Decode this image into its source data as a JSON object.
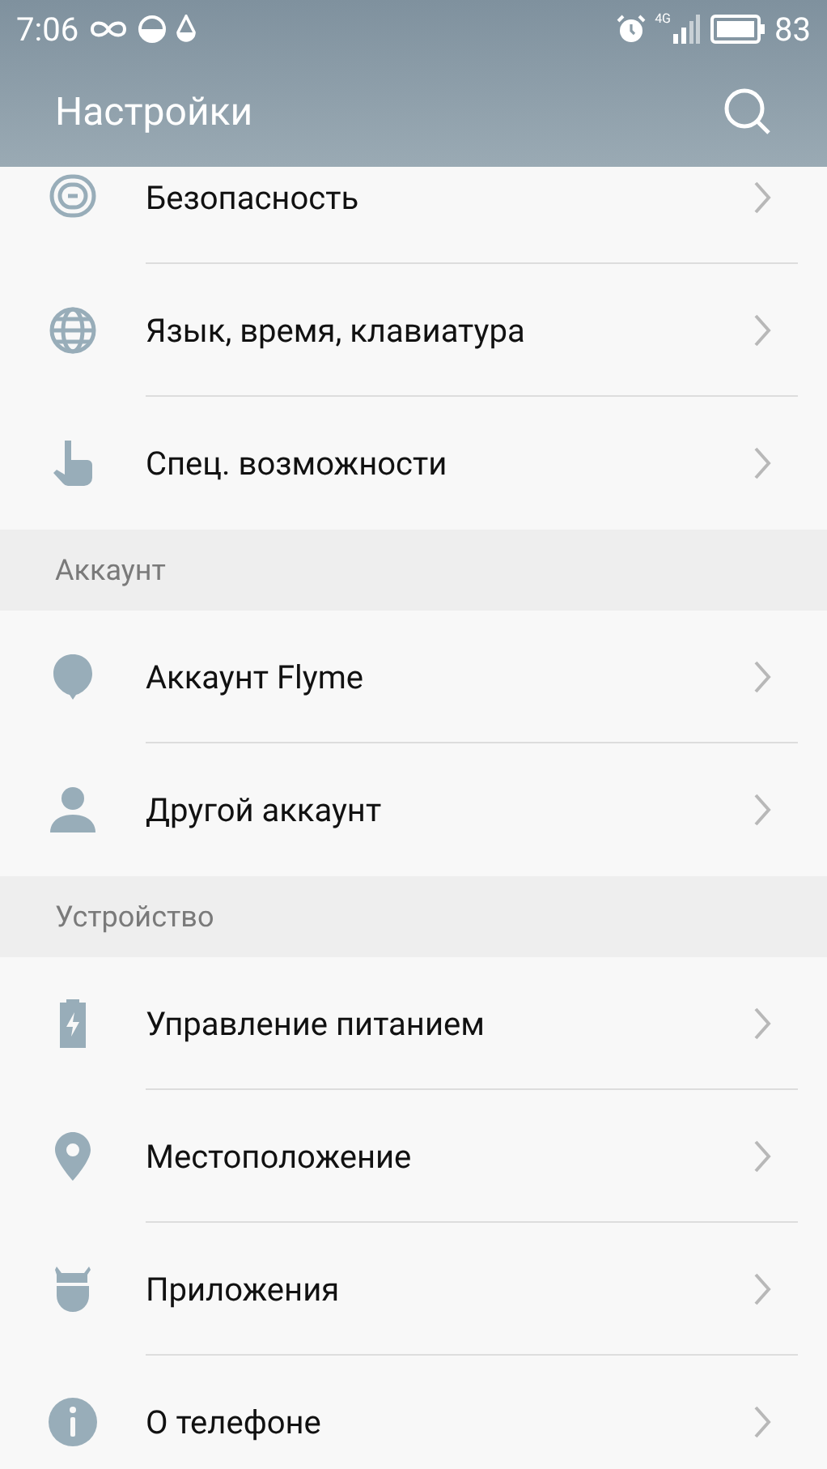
{
  "status_bar": {
    "time": "7:06",
    "network": "4G",
    "battery": "83"
  },
  "header": {
    "title": "Настройки"
  },
  "sections": [
    {
      "items": [
        {
          "label": "Безопасность"
        },
        {
          "label": "Язык, время, клавиатура"
        },
        {
          "label": "Спец. возможности"
        }
      ]
    },
    {
      "title": "Аккаунт",
      "items": [
        {
          "label": "Аккаунт Flyme"
        },
        {
          "label": "Другой аккаунт"
        }
      ]
    },
    {
      "title": "Устройство",
      "items": [
        {
          "label": "Управление питанием"
        },
        {
          "label": "Местоположение"
        },
        {
          "label": "Приложения"
        },
        {
          "label": "О телефоне"
        }
      ]
    }
  ]
}
